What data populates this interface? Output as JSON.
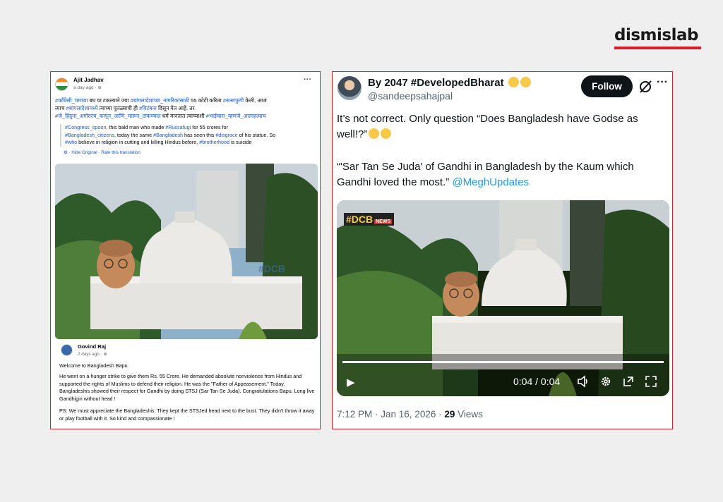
{
  "logo": {
    "text": "dismislab"
  },
  "facebook_post": {
    "author": "Ajit Jadhav",
    "time": "a day ago · ⊕",
    "more": "···",
    "body_line1_a": "#काँग्रेसी_चमच्या",
    "body_line1_b": " बघ या टकल्याने ज्या ",
    "body_line1_c": "#बांगलादेशाच्या_नागरिकांसाठी",
    "body_line1_d": " 55 कोटी करिता ",
    "body_line1_e": "#रूसाफुगी",
    "body_line1_f": " केली, आज",
    "body_line2_a": "त्याच ",
    "body_line2_b": "#बांगलादेशामध्ये",
    "body_line2_c": " त्याच्या पुतळ्याची ही ",
    "body_line2_d": "#विटंबना",
    "body_line2_e": " दिसून येत आहे. तर",
    "body_line3_a": "#जे_हिंदुना_अगोदरच_कापून_आणि_मारून_टाकण्यात",
    "body_line3_b": " धर्म मानतात त्याच्याशी ",
    "body_line3_c": "#भाईचारा_म्हणजे_आत्महत्याच",
    "translation_line1_a": "#Congress_spoon",
    "translation_line1_b": ", this bald man who made ",
    "translation_line1_c": "#Russafugi",
    "translation_line1_d": " for 55 crores for",
    "translation_line2_a": "#Bangladesh_citizens",
    "translation_line2_b": ", today the same ",
    "translation_line2_c": "#Bangladesh",
    "translation_line2_d": " has seen this ",
    "translation_line2_e": "#disgrace",
    "translation_line2_f": " of his statue. So",
    "translation_line3_a": "#who",
    "translation_line3_b": " believe in religion in cutting and killing Hindus before, ",
    "translation_line3_c": "#brotherhood",
    "translation_line3_d": " is suicide",
    "translation_link": "⚙ · Hide Original · Rate this translation",
    "comment": {
      "author": "Govind Raj",
      "time": "2 days ago · ⊕",
      "p1": "Welcome to Bangladesh Bapu",
      "p2": "He went on a hunger strike to give them Rs. 55 Crore. He demanded absolute nonviolence from Hindus and supported the rights of Muslims to defend their religion. He was the \"Father of Appeasement.\" Today, Bangladeshis showed their respect for Gandhi by doing STSJ (Sar Tan Se Juda). Congratulations Bapu. Long live Gandhigiri without head !",
      "p3": "PS: We must appreciate the Bangladeshis. They kept the STSJed head next to the bust. They didn't throw it away or play football with it. So kind and compassionate !"
    }
  },
  "tweet": {
    "name": "By 2047 #DevelopedBharat",
    "handle": "@sandeepsahajpal",
    "follow_label": "Follow",
    "more": "···",
    "text1": "It’s not correct. Only question “Does Bangladesh have Godse as well!?”",
    "text2": "“'Sar Tan Se Juda' of Gandhi in Bangladesh by the Kaum which Gandhi loved the most.”",
    "mention": "@MeghUpdates",
    "video_watermark": "#DCB",
    "video_watermark_sub": "NEWS",
    "video_time": "0:04 / 0:04",
    "timestamp": "7:12 PM · Jan 16, 2026 · ",
    "views_count": "29",
    "views_label": " Views"
  }
}
